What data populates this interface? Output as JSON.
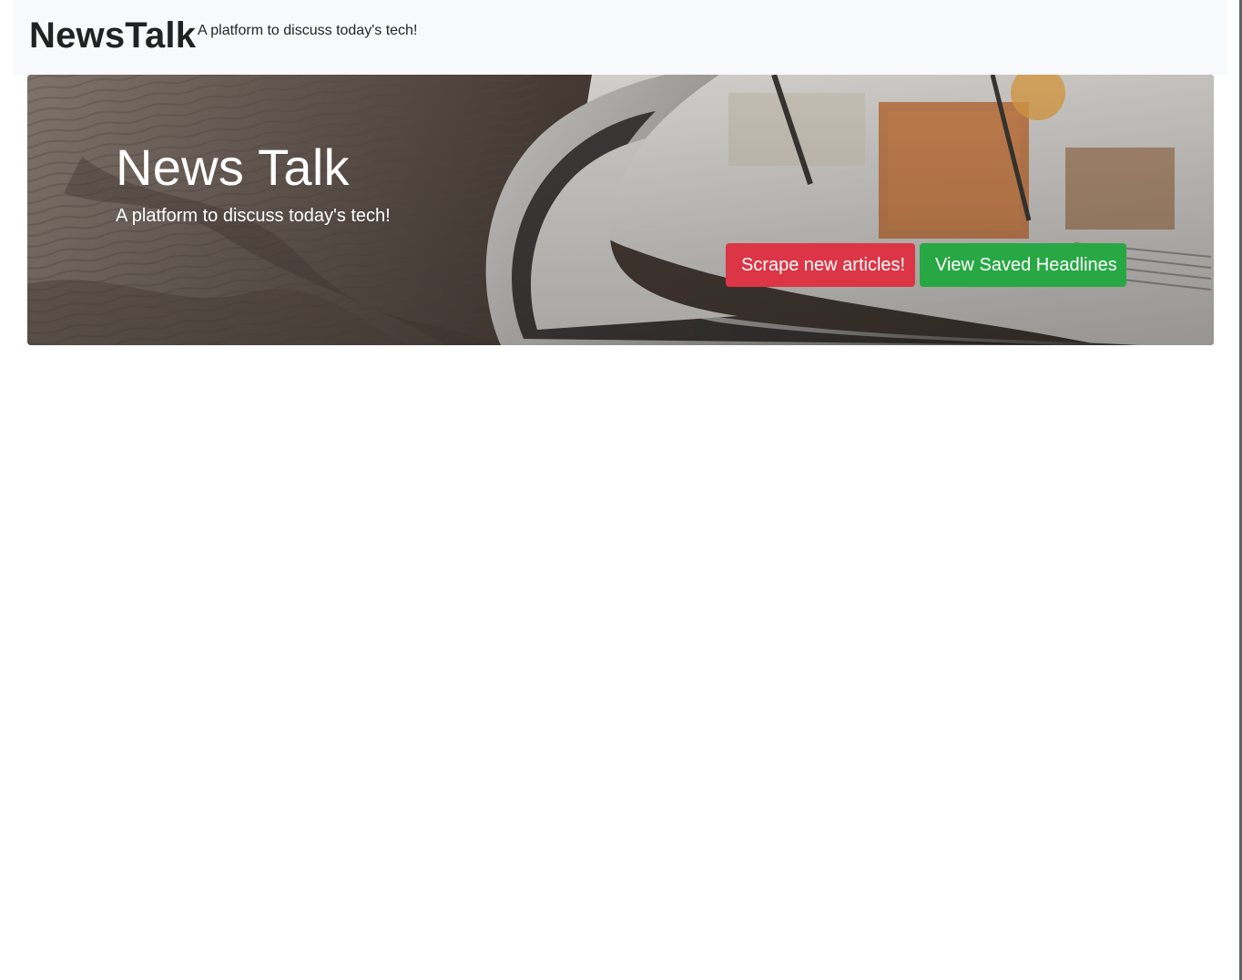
{
  "navbar": {
    "brand": "NewsTalk",
    "tagline": "A platform to discuss today's tech!"
  },
  "hero": {
    "title": "News Talk",
    "subtitle": "A platform to discuss today's tech!",
    "background_image": "open-magazine-on-wooden-table",
    "buttons": {
      "scrape_label": "Scrape new articles!",
      "saved_label": "View Saved Headlines"
    }
  },
  "colors": {
    "navbar_bg": "#f8f9fa",
    "danger": "#dc3545",
    "success": "#28a745",
    "hero_text": "#ffffff"
  }
}
